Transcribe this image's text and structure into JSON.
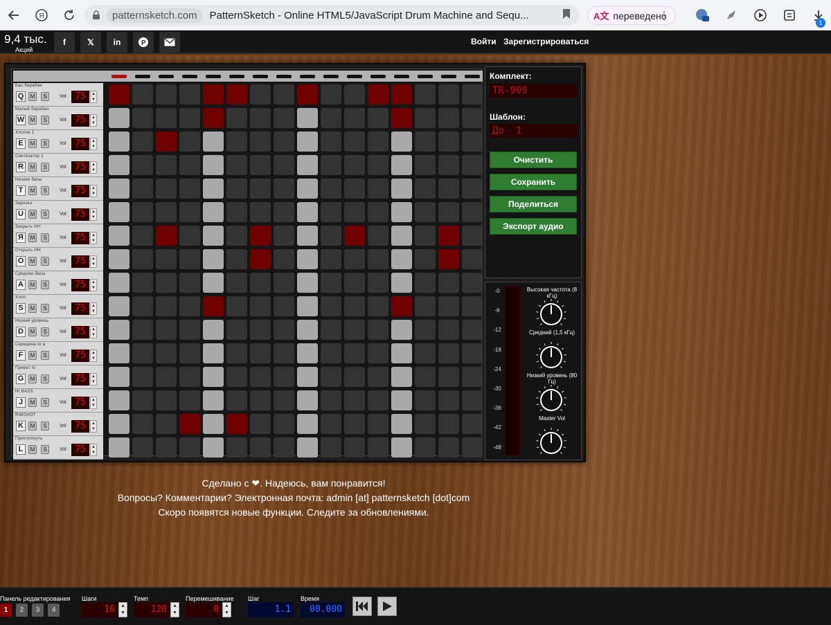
{
  "browser": {
    "domain": "patternsketch.com",
    "page_title": "PatternSketch - Online HTML5/JavaScript Drum Machine and Sequ...",
    "translated_label": "переведено",
    "ext_badge": "1"
  },
  "topbar": {
    "shares_count": "9,4 тыс.",
    "shares_label": "Акций",
    "social": [
      "f",
      "𝕏",
      "in",
      "P",
      "✉"
    ],
    "login": "Войти",
    "register": "Зарегистрироваться"
  },
  "tracks": [
    {
      "name": "Бас-барабан",
      "key": "Q",
      "vol": "75",
      "on": [
        0,
        4,
        5,
        8,
        11,
        12
      ]
    },
    {
      "name": "Малый барабан",
      "key": "W",
      "vol": "75",
      "on": [
        4,
        12
      ]
    },
    {
      "name": "Хлопок 1",
      "key": "E",
      "vol": "75",
      "on": [
        2
      ]
    },
    {
      "name": "Синтезатор 1",
      "key": "R",
      "vol": "75",
      "on": []
    },
    {
      "name": "Низкие басы",
      "key": "T",
      "vol": "75",
      "on": []
    },
    {
      "name": "Зарезка",
      "key": "U",
      "vol": "75",
      "on": []
    },
    {
      "name": "Закрыть HH",
      "key": "Я",
      "vol": "75",
      "on": [
        2,
        6,
        10,
        14
      ]
    },
    {
      "name": "Открыть HH",
      "key": "O",
      "vol": "75",
      "on": [
        6,
        14
      ]
    },
    {
      "name": "Средние басы",
      "key": "A",
      "vol": "75",
      "on": []
    },
    {
      "name": "Хлоп",
      "key": "S",
      "vol": "75",
      "on": [
        4,
        12
      ]
    },
    {
      "name": "Низкий уровень",
      "key": "D",
      "vol": "75",
      "on": []
    },
    {
      "name": "Середина Io a",
      "key": "F",
      "vol": "75",
      "on": []
    },
    {
      "name": "Привет Io",
      "key": "G",
      "vol": "75",
      "on": []
    },
    {
      "name": "HI BASS",
      "key": "J",
      "vol": "75",
      "on": []
    },
    {
      "name": "RIMSHOT",
      "key": "K",
      "vol": "75",
      "on": [
        3,
        5
      ]
    },
    {
      "name": "Прихлопнуть",
      "key": "L",
      "vol": "75",
      "on": []
    }
  ],
  "track_buttons": {
    "mute": "M",
    "solo": "S",
    "vol_label": "Vol"
  },
  "sequencer": {
    "steps": 16,
    "current_step": 0
  },
  "side": {
    "kit_label": "Комплект:",
    "kit_value": "TR-909",
    "pattern_label": "Шаблон:",
    "pattern_value": "До  1",
    "btn_clear": "Очистить",
    "btn_save": "Сохранить",
    "btn_share": "Поделиться",
    "btn_export": "Экспорт аудио"
  },
  "mixer": {
    "scale": [
      "-0",
      "-6",
      "-12",
      "-18",
      "-24",
      "-30",
      "-36",
      "-42",
      "-48"
    ],
    "knobs": [
      {
        "label": "Высокая частота (8 кГц)"
      },
      {
        "label": "Средний (1,5 кГц)"
      },
      {
        "label": "Низкий уровень (80 Гц)"
      },
      {
        "label": "Master Vol"
      }
    ]
  },
  "message": {
    "line1": "Сделано с ❤. Надеюсь, вам понравится!",
    "line2": "Вопросы? Комментарии? Электронная почта: admin [at] patternsketch [dot]com",
    "line3": "Скоро появятся новые функции. Следите за обновлениями."
  },
  "bottom": {
    "panel_label": "Панель редактирования",
    "panels": [
      "1",
      "2",
      "3",
      "4"
    ],
    "active_panel": "1",
    "steps_label": "Шаги",
    "steps_value": "16",
    "tempo_label": "Темп",
    "tempo_value": "120",
    "shuffle_label": "Перемешивание",
    "shuffle_value": "0",
    "step_label": "Шаг",
    "step_value": "1.1",
    "time_label": "Время",
    "time_value": "00.000"
  },
  "colors": {
    "pad_on": "#6e0000",
    "pad_beat": "#a9a9a9",
    "pad_off": "#333333",
    "green_button": "#2e7d32"
  }
}
